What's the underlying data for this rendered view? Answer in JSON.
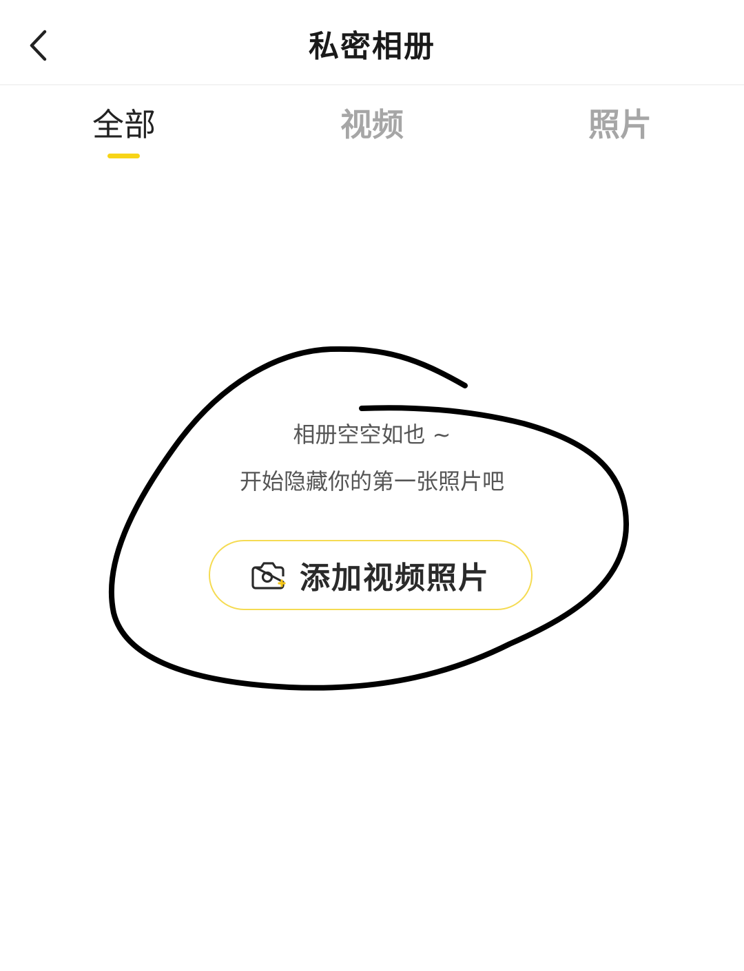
{
  "header": {
    "title": "私密相册",
    "back_icon": "chevron-left-icon"
  },
  "tabs": [
    {
      "label": "全部",
      "active": true
    },
    {
      "label": "视频",
      "active": false
    },
    {
      "label": "照片",
      "active": false
    }
  ],
  "empty_state": {
    "line1": "相册空空如也 ~",
    "line2": "开始隐藏你的第一张照片吧",
    "button_label": "添加视频照片",
    "button_icon": "camera-add-icon"
  },
  "colors": {
    "accent": "#f7d417",
    "button_border": "#f5db52",
    "inactive_tab": "#a6a6a6",
    "text_primary": "#1a1a1a"
  }
}
